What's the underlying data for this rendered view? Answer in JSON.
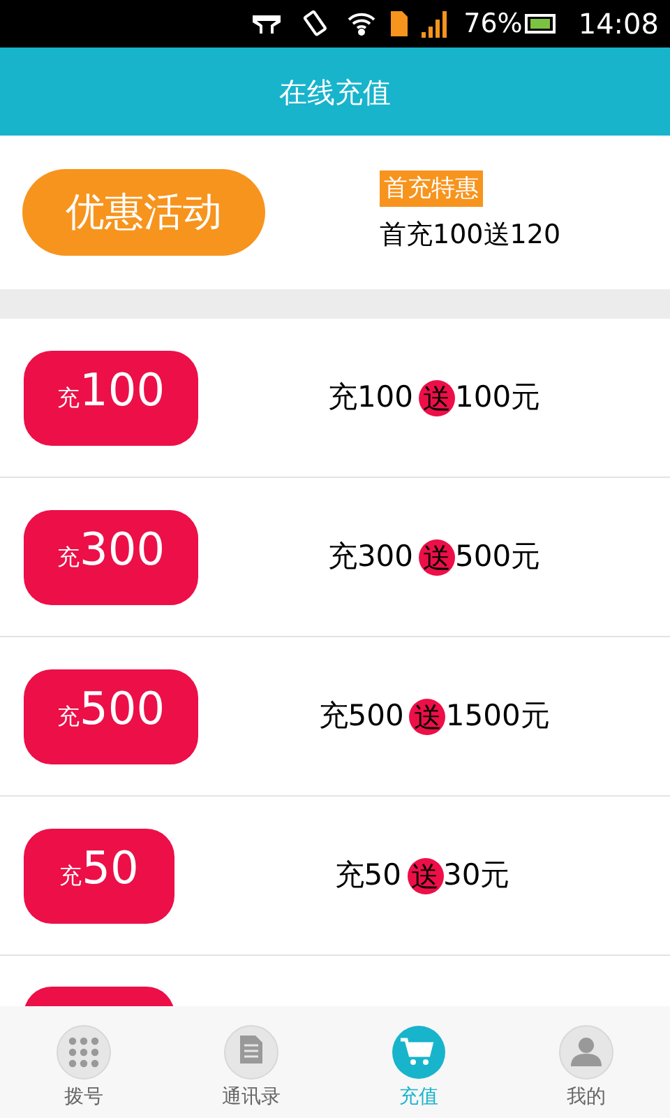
{
  "status_bar": {
    "battery": "76%",
    "time": "14:08"
  },
  "header": {
    "title": "在线充值"
  },
  "promo": {
    "button": "优惠活动",
    "badge": "首充特惠",
    "text": "首充100送120"
  },
  "packages": [
    {
      "prefix": "充",
      "amount": "100",
      "offer_before": "充100",
      "gift": "送",
      "offer_after": "100元"
    },
    {
      "prefix": "充",
      "amount": "300",
      "offer_before": "充300",
      "gift": "送",
      "offer_after": "500元"
    },
    {
      "prefix": "充",
      "amount": "500",
      "offer_before": "充500",
      "gift": "送",
      "offer_after": "1500元"
    },
    {
      "prefix": "充",
      "amount": "50",
      "offer_before": "充50",
      "gift": "送",
      "offer_after": "30元"
    }
  ],
  "nav": [
    {
      "label": "拨号",
      "kind": "dialpad",
      "selected": false
    },
    {
      "label": "通讯录",
      "kind": "contacts",
      "selected": false
    },
    {
      "label": "充值",
      "kind": "cart",
      "selected": true
    },
    {
      "label": "我的",
      "kind": "person",
      "selected": false
    }
  ]
}
